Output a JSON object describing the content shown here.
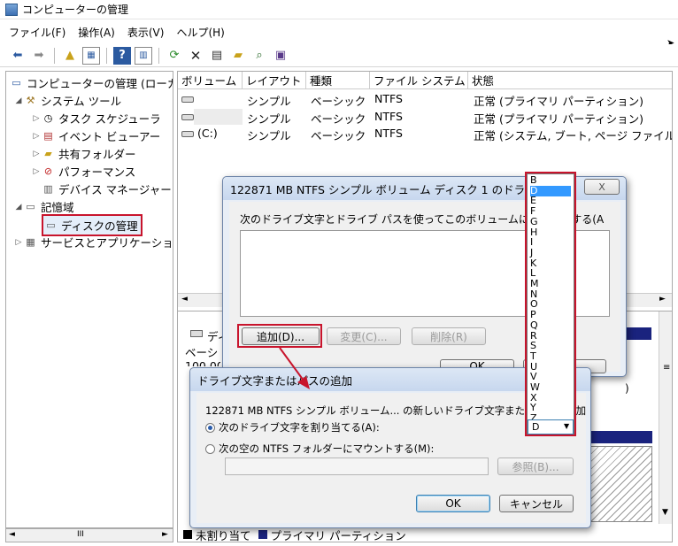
{
  "window": {
    "title": "コンピューターの管理"
  },
  "menu": [
    "ファイル(F)",
    "操作(A)",
    "表示(V)",
    "ヘルプ(H)"
  ],
  "tree": [
    {
      "label": "コンピューターの管理 (ローカ",
      "icon": "computer-icon"
    },
    {
      "label": "システム ツール",
      "icon": "tools-icon"
    },
    {
      "label": "タスク スケジューラ",
      "icon": "clock-icon"
    },
    {
      "label": "イベント ビューアー",
      "icon": "event-viewer-icon"
    },
    {
      "label": "共有フォルダー",
      "icon": "shared-folder-icon"
    },
    {
      "label": "パフォーマンス",
      "icon": "performance-icon"
    },
    {
      "label": "デバイス マネージャー",
      "icon": "device-manager-icon"
    },
    {
      "label": "記憶域",
      "icon": "storage-icon"
    },
    {
      "label": "ディスクの管理",
      "icon": "disk-management-icon"
    },
    {
      "label": "サービスとアプリケーショ",
      "icon": "services-icon"
    }
  ],
  "volume_table": {
    "headers": [
      "ボリューム",
      "レイアウト",
      "種類",
      "ファイル システム",
      "状態"
    ],
    "rows": [
      [
        "",
        "シンプル",
        "ベーシック",
        "NTFS",
        "正常 (プライマリ パーティション)"
      ],
      [
        "",
        "シンプル",
        "ベーシック",
        "NTFS",
        "正常 (プライマリ パーティション)"
      ],
      [
        "(C:)",
        "シンプル",
        "ベーシック",
        "NTFS",
        "正常 (システム, ブート, ページ ファイル"
      ]
    ]
  },
  "disk_pane": {
    "label_short": "ディ",
    "type_short": "ベーシ",
    "size_short": "100.00",
    "legend_unallocated": "未割り当て",
    "legend_primary": "プライマリ パーティション"
  },
  "drive_dialog": {
    "title": "122871 MB NTFS シンプル ボリューム ディスク 1 のドライ",
    "instruction": "次のドライブ文字とドライブ パスを使ってこのボリュームにアクセスする(A",
    "add": "追加(D)...",
    "change": "変更(C)...",
    "remove": "削除(R)",
    "ok": "OK",
    "close_glyph": "X"
  },
  "add_dialog": {
    "title": "ドライブ文字またはパスの追加",
    "description": "122871 MB NTFS シンプル ボリューム... の新しいドライブ文字またはパスを追加",
    "option_letter": "次のドライブ文字を割り当てる(A):",
    "option_folder": "次の空の NTFS フォルダーにマウントする(M):",
    "browse": "参照(B)...",
    "ok": "OK",
    "cancel": "キャンセル"
  },
  "drive_letters": [
    "B",
    "D",
    "E",
    "F",
    "G",
    "H",
    "I",
    "J",
    "K",
    "L",
    "M",
    "N",
    "O",
    "P",
    "Q",
    "R",
    "S",
    "T",
    "U",
    "V",
    "W",
    "X",
    "Y",
    "Z"
  ],
  "selected_letter": "D",
  "dropdown_value": "D",
  "scroll": {
    "left": "◄",
    "right": "►",
    "grip": "III"
  },
  "colors": {
    "highlight": "#c8142c",
    "selection": "#3399ff",
    "primary_partition": "#1a237e"
  }
}
